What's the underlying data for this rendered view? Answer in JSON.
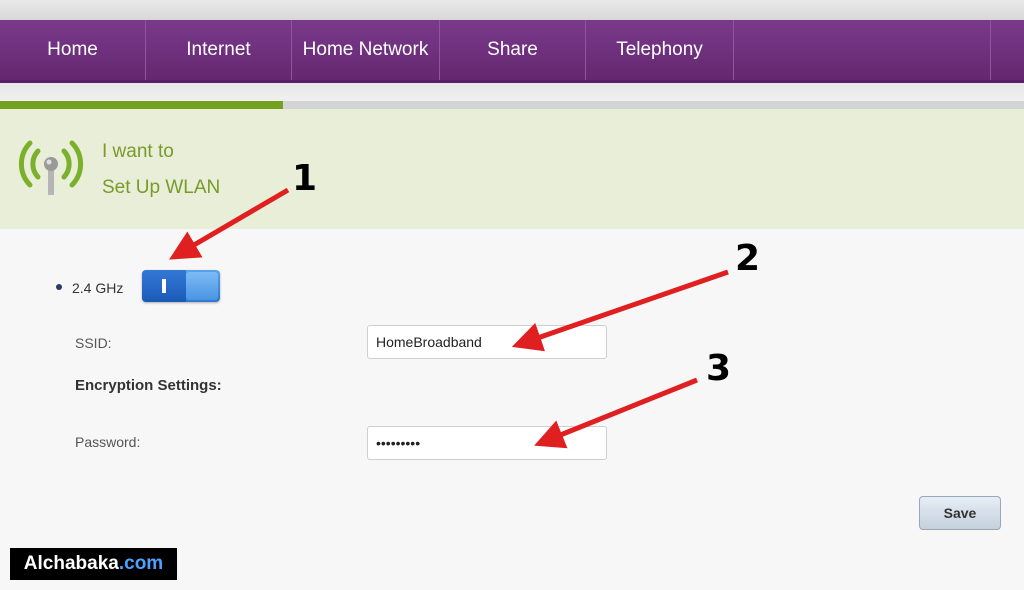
{
  "nav": {
    "items": [
      {
        "label": "Home"
      },
      {
        "label": "Internet"
      },
      {
        "label": "Home Network"
      },
      {
        "label": "Share"
      },
      {
        "label": "Telephony"
      }
    ]
  },
  "progress": {
    "value": 0.276
  },
  "banner": {
    "line1": "I want to",
    "line2": "Set Up WLAN",
    "icon": "wifi-antenna-icon"
  },
  "band": {
    "label": "2.4 GHz",
    "enabled": true
  },
  "ssid": {
    "label": "SSID:",
    "value": "HomeBroadband"
  },
  "encryption": {
    "heading": "Encryption Settings:"
  },
  "password": {
    "label": "Password:",
    "value": "•••••••••"
  },
  "save": {
    "label": "Save"
  },
  "annotations": {
    "n1": "1",
    "n2": "2",
    "n3": "3"
  },
  "watermark": {
    "main": "Alchabaka",
    "domain": ".com"
  },
  "colors": {
    "nav": "#6b2d78",
    "accent": "#74a11f",
    "toggle": "#2f77cf",
    "arrow": "#e02020"
  }
}
